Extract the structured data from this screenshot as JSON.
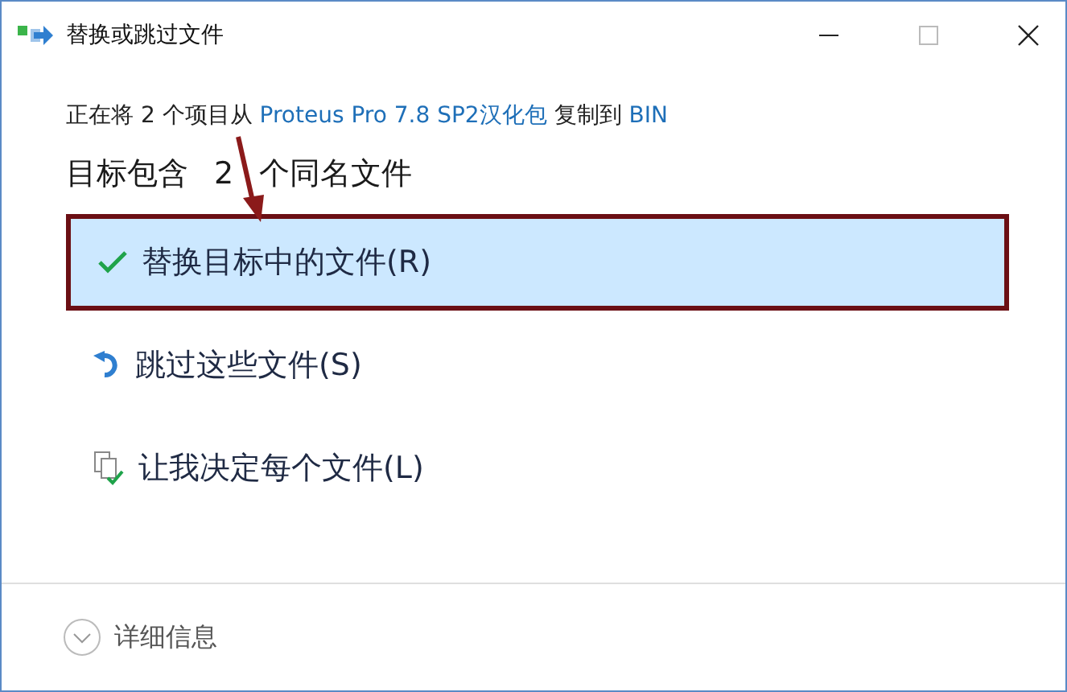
{
  "window": {
    "title": "替换或跳过文件"
  },
  "status": {
    "before": "正在将 2 个项目从 ",
    "source": "Proteus Pro 7.8 SP2汉化包",
    "middle": " 复制到 ",
    "destination": "BIN"
  },
  "heading": "目标包含 2 个同名文件",
  "options": [
    {
      "kind": "replace",
      "label": "替换目标中的文件(R)",
      "selected": true
    },
    {
      "kind": "skip",
      "label": "跳过这些文件(S)",
      "selected": false
    },
    {
      "kind": "decide",
      "label": "让我决定每个文件(L)",
      "selected": false
    }
  ],
  "details": {
    "label": "详细信息",
    "expanded": false
  },
  "annotation": {
    "arrow": true,
    "frame_on_selected": true
  }
}
